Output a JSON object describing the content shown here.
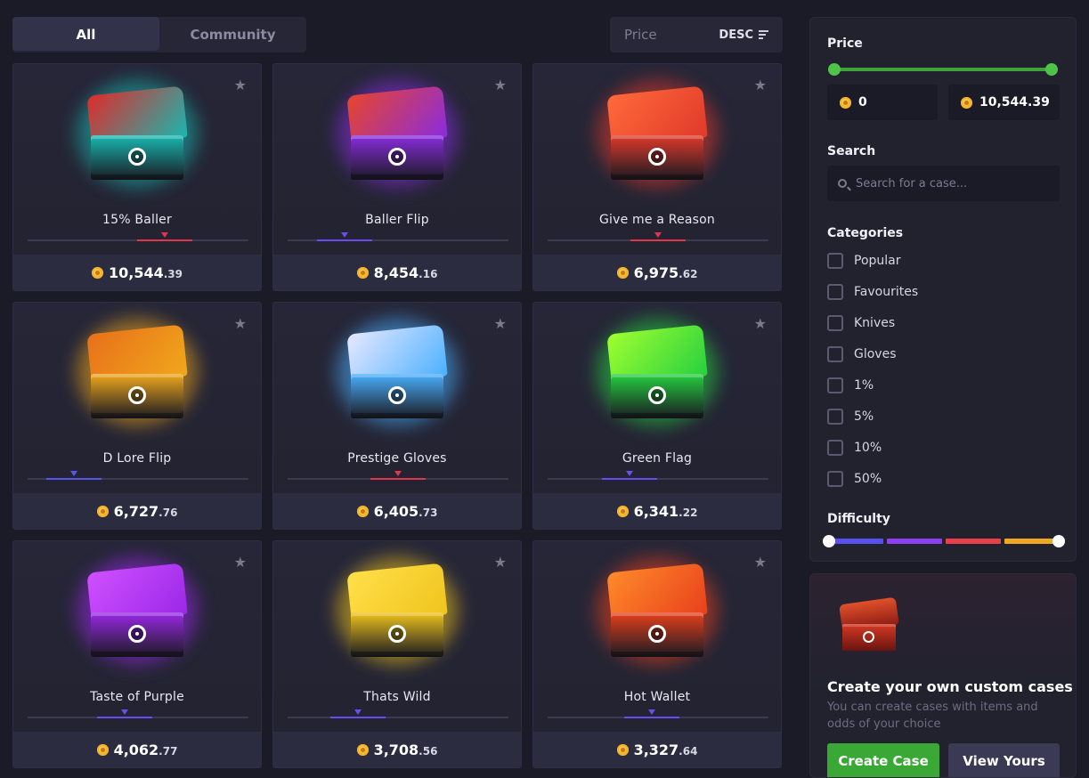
{
  "tabs": [
    {
      "label": "All"
    },
    {
      "label": "Community"
    }
  ],
  "sort": {
    "field": "Price",
    "direction": "DESC"
  },
  "cases": [
    {
      "name": "15% Baller",
      "price_main": "10,544",
      "price_cents": ".39",
      "color": "#18b8b0",
      "color2": "#e02a2a",
      "bar_color": "#e0364a",
      "level": 0.62
    },
    {
      "name": "Baller Flip",
      "price_main": "8,454",
      "price_cents": ".16",
      "color": "#8a2ce0",
      "color2": "#e8452a",
      "bar_color": "#6a4cf0",
      "level": 0.26
    },
    {
      "name": "Give me a Reason",
      "price_main": "6,975",
      "price_cents": ".62",
      "color": "#e0392a",
      "color2": "#ff6a3a",
      "bar_color": "#e0364a",
      "level": 0.5
    },
    {
      "name": "D Lore Flip",
      "price_main": "6,727",
      "price_cents": ".76",
      "color": "#f0a81c",
      "color2": "#e8701a",
      "bar_color": "#5a54ee",
      "level": 0.21
    },
    {
      "name": "Prestige Gloves",
      "price_main": "6,405",
      "price_cents": ".73",
      "color": "#4ab0ff",
      "color2": "#e8e8ff",
      "bar_color": "#e0364a",
      "level": 0.5
    },
    {
      "name": "Green Flag",
      "price_main": "6,341",
      "price_cents": ".22",
      "color": "#26d040",
      "color2": "#a0ff30",
      "bar_color": "#6a4cf0",
      "level": 0.37
    },
    {
      "name": "Taste of Purple",
      "price_main": "4,062",
      "price_cents": ".77",
      "color": "#9a28e8",
      "color2": "#d050ff",
      "bar_color": "#6a4cf0",
      "level": 0.44
    },
    {
      "name": "Thats Wild",
      "price_main": "3,708",
      "price_cents": ".56",
      "color": "#f0c41c",
      "color2": "#ffe04a",
      "bar_color": "#6a4cf0",
      "level": 0.32
    },
    {
      "name": "Hot Wallet",
      "price_main": "3,327",
      "price_cents": ".64",
      "color": "#e8401c",
      "color2": "#ff8a2a",
      "bar_color": "#6a4cf0",
      "level": 0.47
    }
  ],
  "filters": {
    "price_title": "Price",
    "price_min": "0",
    "price_max": "10,544.39",
    "search_title": "Search",
    "search_placeholder": "Search for a case...",
    "categories_title": "Categories",
    "categories": [
      "Popular",
      "Favourites",
      "Knives",
      "Gloves",
      "1%",
      "5%",
      "10%",
      "50%"
    ],
    "difficulty_title": "Difficulty",
    "difficulty_colors": [
      "#5a50f0",
      "#8a40ee",
      "#e8404a",
      "#f0a820"
    ]
  },
  "promo": {
    "title": "Create your own custom cases",
    "text": "You can create cases with items and odds of your choice",
    "create_label": "Create Case",
    "view_label": "View Yours",
    "create_color": "#3aa835"
  }
}
